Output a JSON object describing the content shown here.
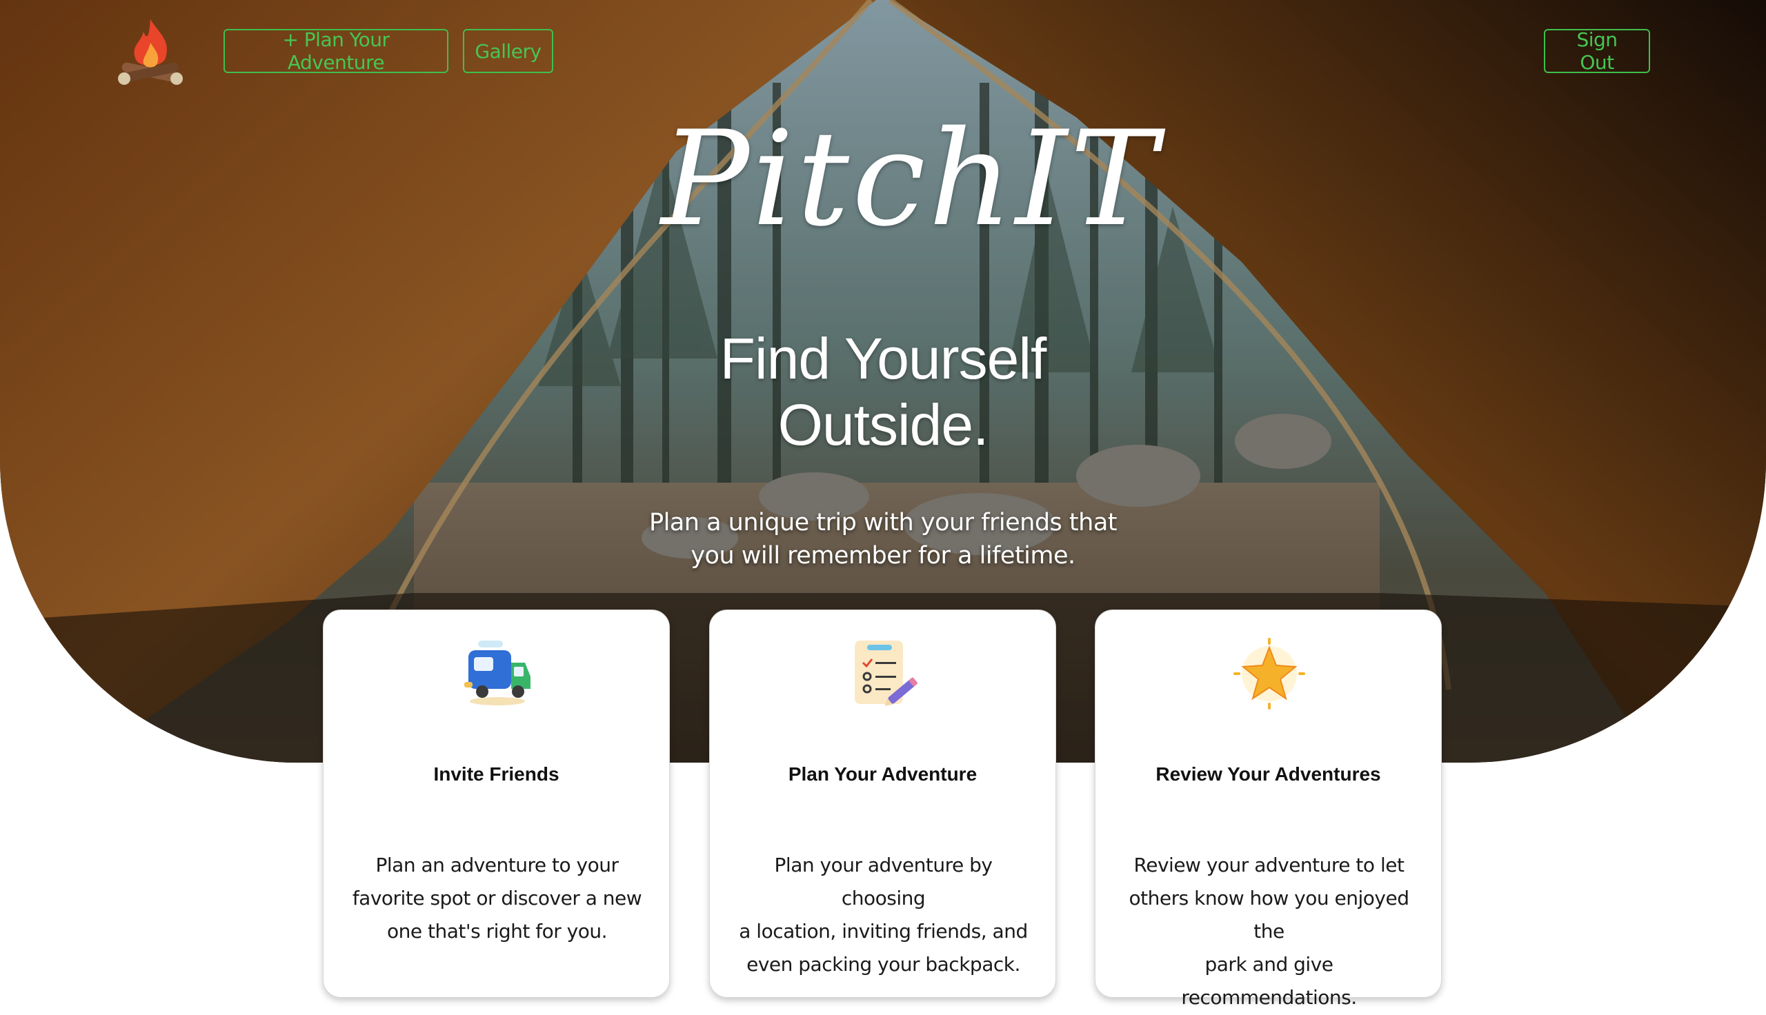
{
  "nav": {
    "logo_icon": "campfire-icon",
    "plan_button": "+ Plan Your Adventure",
    "gallery_button": "Gallery",
    "signout_button": "Sign Out",
    "accent_color": "#46c653"
  },
  "hero": {
    "title": "PitchIT",
    "headline_line1": "Find Yourself",
    "headline_line2": "Outside.",
    "tagline_line1": "Plan a unique trip with your friends that",
    "tagline_line2": "you will remember for a lifetime.",
    "background": "tent-opening-forest-photo"
  },
  "cards": [
    {
      "icon": "camper-van-icon",
      "title": "Invite Friends",
      "text_line1": "Plan an adventure to your",
      "text_line2": "favorite spot or discover a new",
      "text_line3": "one that's right for you."
    },
    {
      "icon": "checklist-pencil-icon",
      "title": "Plan Your Adventure",
      "text_line1": "Plan your adventure by choosing",
      "text_line2": "a location, inviting friends, and",
      "text_line3": "even packing your backpack."
    },
    {
      "icon": "star-icon",
      "title": "Review Your Adventures",
      "text_line1": "Review your adventure to let",
      "text_line2": "others know how you enjoyed the",
      "text_line3": "park and give recommendations."
    }
  ]
}
